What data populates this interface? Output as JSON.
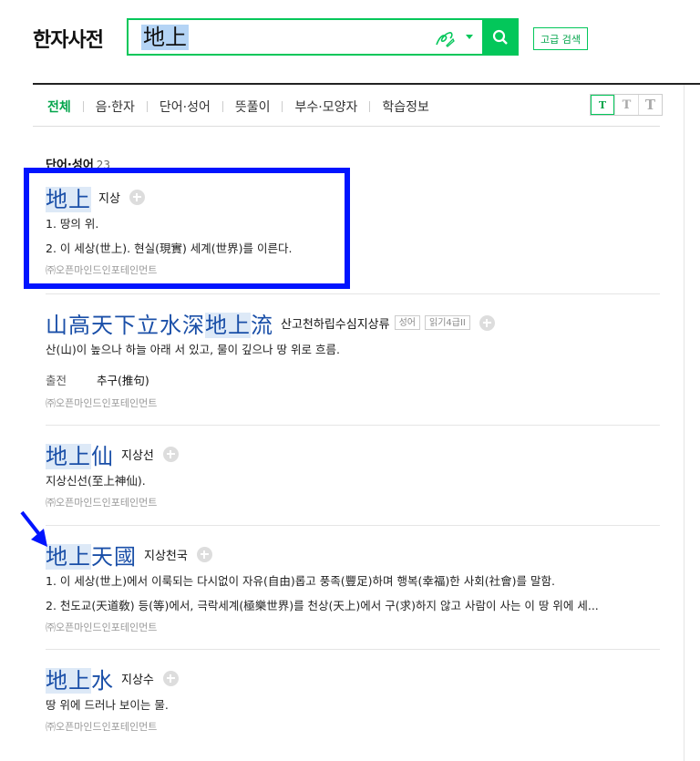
{
  "header": {
    "logo": "한자사전",
    "search_value": "地上",
    "advanced_search": "고급 검색"
  },
  "tabs": [
    {
      "label": "전체",
      "active": true
    },
    {
      "label": "음·한자"
    },
    {
      "label": "단어·성어"
    },
    {
      "label": "뜻풀이"
    },
    {
      "label": "부수·모양자"
    },
    {
      "label": "학습정보"
    }
  ],
  "font_size_buttons": [
    "T",
    "T",
    "T"
  ],
  "section": {
    "title": "단어·성어",
    "count": "23"
  },
  "entries": [
    {
      "hanja_hl": "地上",
      "hanja_rest": "",
      "hanja_pre": "",
      "reading": "지상",
      "defs": [
        "1. 땅의 위.",
        "2. 이 세상(世上). 현실(現實) 세계(世界)를 이른다."
      ],
      "source": "㈜오픈마인드인포테인먼트"
    },
    {
      "hanja_pre": "山高天下立水深",
      "hanja_hl": "地上",
      "hanja_rest": "流",
      "reading": "산고천하립수심지상류",
      "badges": [
        "성어",
        "읽기4급II"
      ],
      "defs": [
        "산(山)이 높으나 하늘 아래 서 있고, 물이 깊으나 땅 위로 흐름."
      ],
      "origin_label": "출전",
      "origin_value": "추구(推句)",
      "source": "㈜오픈마인드인포테인먼트"
    },
    {
      "hanja_pre": "",
      "hanja_hl": "地上",
      "hanja_rest": "仙",
      "reading": "지상선",
      "defs": [
        "지상신선(至上神仙)."
      ],
      "source": "㈜오픈마인드인포테인먼트"
    },
    {
      "hanja_pre": "",
      "hanja_hl": "地上",
      "hanja_rest": "天國",
      "reading": "지상천국",
      "defs": [
        "1. 이 세상(世上)에서 이룩되는 다시없이 자유(自由)롭고 풍족(豐足)하며 행복(幸福)한 사회(社會)를 말함.",
        "2. 천도교(天道敎) 등(等)에서, 극락세계(極樂世界)를 천상(天上)에서 구(求)하지 않고 사람이 사는 이 땅 위에 세..."
      ],
      "source": "㈜오픈마인드인포테인먼트"
    },
    {
      "hanja_pre": "",
      "hanja_hl": "地上",
      "hanja_rest": "水",
      "reading": "지상수",
      "defs": [
        "땅 위에 드러나 보이는 물."
      ],
      "source": "㈜오픈마인드인포테인먼트"
    }
  ],
  "colors": {
    "accent": "#03c75a",
    "hanja": "#1a4fa8",
    "annotation": "#0014ff"
  }
}
